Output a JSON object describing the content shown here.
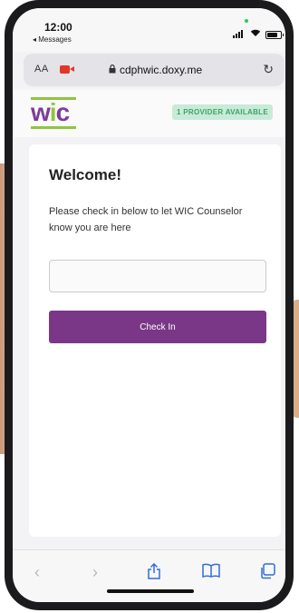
{
  "status_bar": {
    "time": "12:00",
    "back_app": "◂ Messages"
  },
  "browser": {
    "text_size_label": "AA",
    "url": "cdphwic.doxy.me"
  },
  "site": {
    "logo_letters": [
      "w",
      "i",
      "c"
    ],
    "provider_badge": "1 PROVIDER AVAILABLE"
  },
  "checkin": {
    "heading": "Welcome!",
    "description": "Please check in below to let WIC Counselor know you are here",
    "name_value": "",
    "button_label": "Check In"
  },
  "colors": {
    "brand_purple": "#7a3787",
    "wic_green": "#8dc63f",
    "badge_bg": "#c9ead6",
    "badge_text": "#3aa56a",
    "ios_blue": "#2f6fd6"
  },
  "icons": {
    "wifi": "wifi-icon",
    "battery": "battery-icon",
    "camera": "video-camera-icon",
    "lock": "lock-icon",
    "reload": "reload-icon",
    "back": "back-arrow-icon",
    "forward": "forward-arrow-icon",
    "share": "share-icon",
    "bookmarks": "bookmarks-icon",
    "tabs": "tabs-icon"
  }
}
